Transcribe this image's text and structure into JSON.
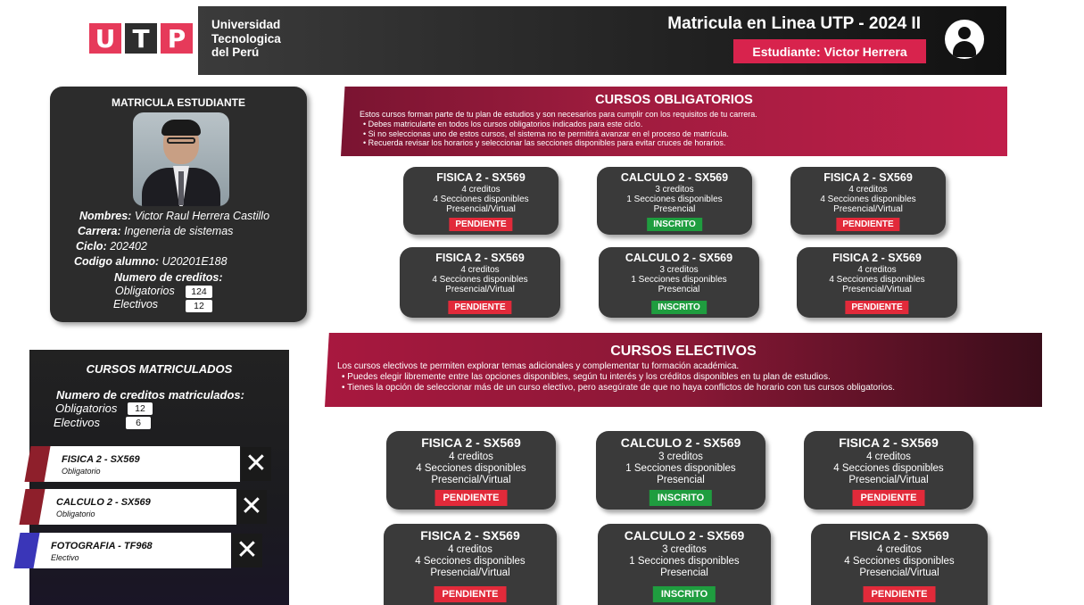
{
  "header": {
    "logo_letters": [
      "U",
      "T",
      "P"
    ],
    "university_lines": [
      "Universidad",
      "Tecnologica",
      "del Perú"
    ],
    "title": "Matricula en Linea UTP - 2024 II",
    "student_badge": "Estudiante: Victor Herrera",
    "user_icon": "user-avatar-icon"
  },
  "student_card": {
    "title": "MATRICULA ESTUDIANTE",
    "fields": [
      {
        "label": "Nombres:",
        "value": "Victor Raul Herrera Castillo"
      },
      {
        "label": "Carrera:",
        "value": "Ingeneria de sistemas"
      },
      {
        "label": "Ciclo:",
        "value": "202402"
      },
      {
        "label": "Codigo alumno:",
        "value": "U20201E188"
      }
    ],
    "credits_title": "Numero de creditos:",
    "credits": [
      {
        "label": "Obligatorios",
        "value": "124"
      },
      {
        "label": "Electivos",
        "value": "12"
      }
    ]
  },
  "enrolled": {
    "title": "CURSOS MATRICULADOS",
    "credits_title": "Numero de creditos matriculados:",
    "credits": [
      {
        "label": "Obligatorios",
        "value": "12"
      },
      {
        "label": "Electivos",
        "value": "6"
      }
    ],
    "items": [
      {
        "name": "FISICA 2 - SX569",
        "type": "Obligatorio"
      },
      {
        "name": "CALCULO 2 - SX569",
        "type": "Obligatorio"
      },
      {
        "name": "FOTOGRAFIA - TF968",
        "type": "Electivo"
      }
    ],
    "remove_label": "✕"
  },
  "obligatorios": {
    "title": "CURSOS OBLIGATORIOS",
    "intro": "Estos cursos forman parte de tu plan de estudios y son necesarios para cumplir con los requisitos de tu carrera.",
    "bullets": [
      "Debes matricularte en todos los cursos obligatorios indicados para este ciclo.",
      "Si no seleccionas uno de estos cursos, el sistema no te permitirá avanzar en el proceso de matrícula.",
      "Recuerda revisar los horarios y seleccionar las secciones disponibles para evitar cruces de horarios."
    ],
    "courses": [
      {
        "name": "FISICA 2 - SX569",
        "credits": "4 creditos",
        "sections": "4 Secciones disponibles",
        "mode": "Presencial/Virtual",
        "status": "PENDIENTE"
      },
      {
        "name": "CALCULO 2 - SX569",
        "credits": "3 creditos",
        "sections": "1 Secciones disponibles",
        "mode": "Presencial",
        "status": "INSCRITO"
      },
      {
        "name": "FISICA 2 - SX569",
        "credits": "4 creditos",
        "sections": "4 Secciones disponibles",
        "mode": "Presencial/Virtual",
        "status": "PENDIENTE"
      },
      {
        "name": "FISICA 2 - SX569",
        "credits": "4 creditos",
        "sections": "4 Secciones disponibles",
        "mode": "Presencial/Virtual",
        "status": "PENDIENTE"
      },
      {
        "name": "CALCULO 2 - SX569",
        "credits": "3 creditos",
        "sections": "1 Secciones disponibles",
        "mode": "Presencial",
        "status": "INSCRITO"
      },
      {
        "name": "FISICA 2 - SX569",
        "credits": "4 creditos",
        "sections": "4 Secciones disponibles",
        "mode": "Presencial/Virtual",
        "status": "PENDIENTE"
      }
    ]
  },
  "electivos": {
    "title": "CURSOS ELECTIVOS",
    "intro": "Los cursos electivos te permiten explorar temas adicionales y complementar tu formación académica.",
    "bullets": [
      "Puedes elegir libremente entre las opciones disponibles, según tu interés y los créditos disponibles en tu plan de estudios.",
      "Tienes la opción de seleccionar más de un curso electivo, pero asegúrate de que no haya conflictos de horario con tus cursos obligatorios."
    ],
    "courses": [
      {
        "name": "FISICA 2 - SX569",
        "credits": "4 creditos",
        "sections": "4 Secciones disponibles",
        "mode": "Presencial/Virtual",
        "status": "PENDIENTE"
      },
      {
        "name": "CALCULO 2 - SX569",
        "credits": "3 creditos",
        "sections": "1 Secciones disponibles",
        "mode": "Presencial",
        "status": "INSCRITO"
      },
      {
        "name": "FISICA 2 - SX569",
        "credits": "4 creditos",
        "sections": "4 Secciones disponibles",
        "mode": "Presencial/Virtual",
        "status": "PENDIENTE"
      },
      {
        "name": "FISICA 2 - SX569",
        "credits": "4 creditos",
        "sections": "4 Secciones disponibles",
        "mode": "Presencial/Virtual",
        "status": "PENDIENTE"
      },
      {
        "name": "CALCULO 2 - SX569",
        "credits": "3 creditos",
        "sections": "1 Secciones disponibles",
        "mode": "Presencial",
        "status": "INSCRITO"
      },
      {
        "name": "FISICA 2 - SX569",
        "credits": "4 creditos",
        "sections": "4 Secciones disponibles",
        "mode": "Presencial/Virtual",
        "status": "PENDIENTE"
      }
    ]
  },
  "colors": {
    "brand_pink": "#e63a5a",
    "badge_red": "#d8234d",
    "status_pending": "#e22a3a",
    "status_enrolled": "#1f9d3f",
    "card_dark": "#3a3a3a"
  }
}
